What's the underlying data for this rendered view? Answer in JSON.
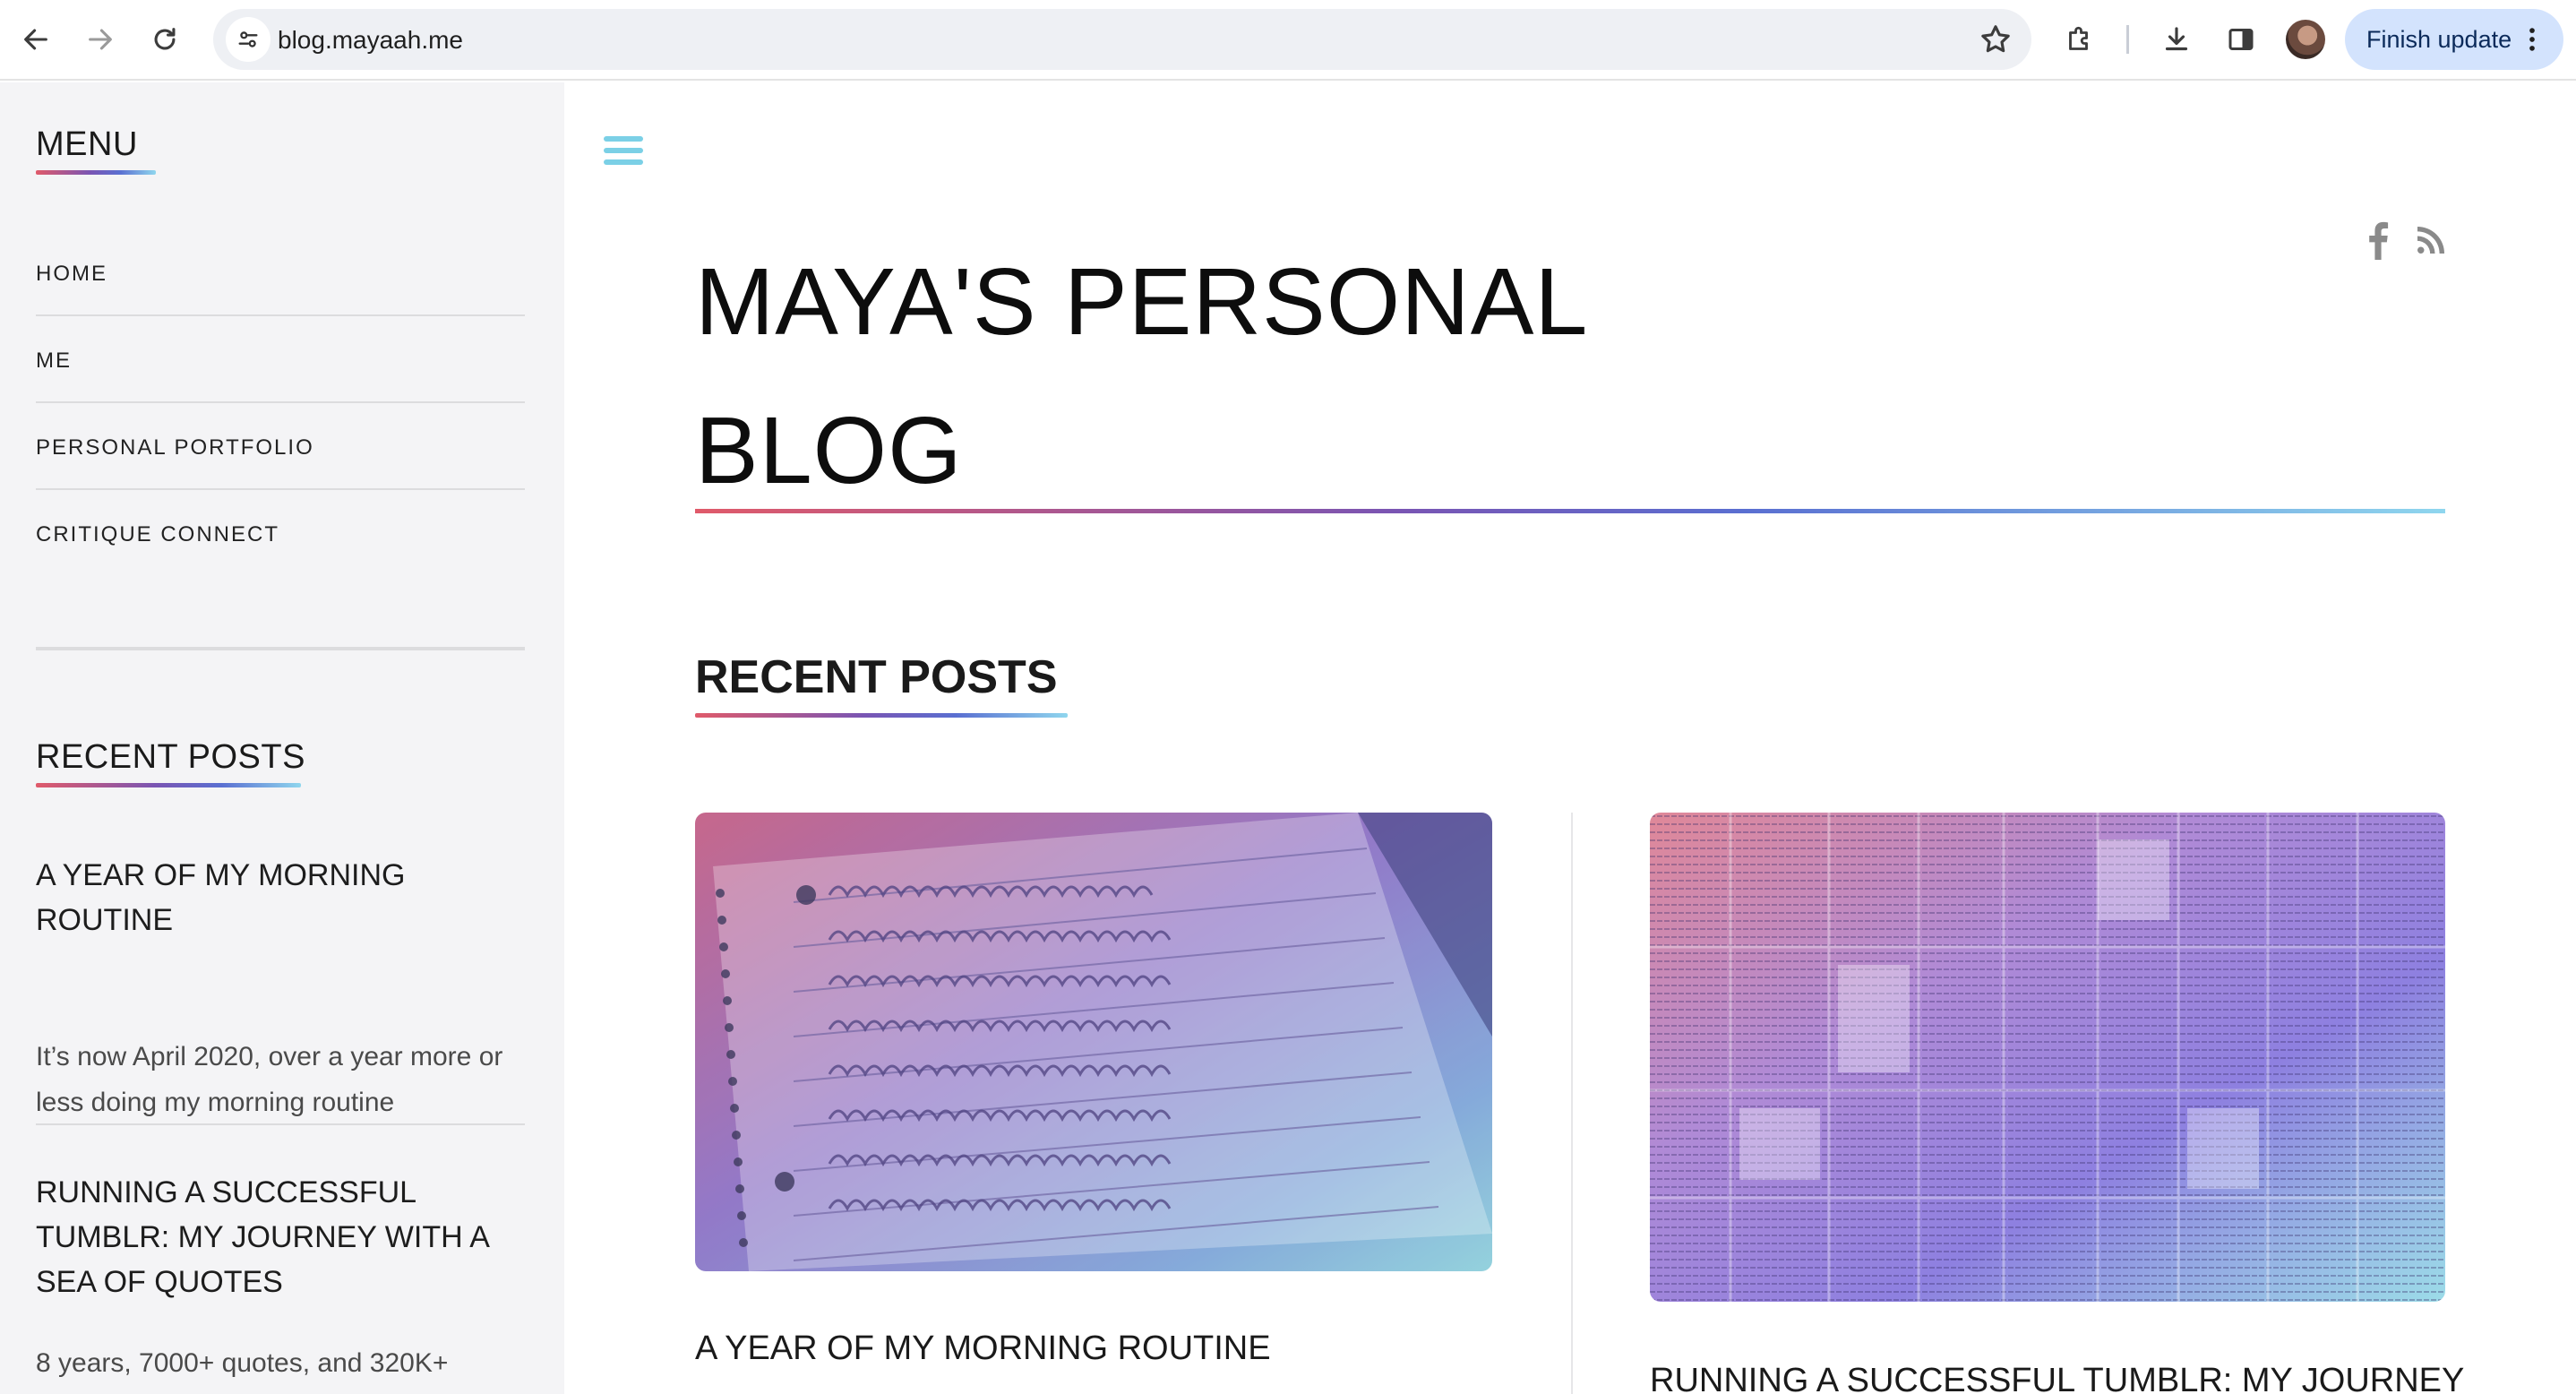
{
  "browser": {
    "url": "blog.mayaah.me",
    "finish_update_label": "Finish update"
  },
  "sidebar": {
    "menu_title": "MENU",
    "menu_items": [
      {
        "label": "HOME"
      },
      {
        "label": "ME"
      },
      {
        "label": "PERSONAL PORTFOLIO"
      },
      {
        "label": "CRITIQUE CONNECT"
      }
    ],
    "recent_title": "RECENT POSTS",
    "recent_posts": [
      {
        "title": "A YEAR OF MY MORNING ROUTINE",
        "excerpt": "It’s now April 2020, over a year more or less doing my morning routine"
      },
      {
        "title": "RUNNING A SUCCESSFUL TUMBLR: MY JOURNEY WITH A SEA OF QUOTES",
        "excerpt": "8 years, 7000+ quotes, and 320K+"
      }
    ]
  },
  "main": {
    "site_title": "MAYA'S PERSONAL BLOG",
    "recent_heading": "RECENT POSTS",
    "posts": [
      {
        "title": "A YEAR OF MY MORNING ROUTINE",
        "image": "handwritten-devanagari-notebook-photo"
      },
      {
        "title": "RUNNING A SUCCESSFUL TUMBLR: MY JOURNEY",
        "image": "collage-of-quote-screenshots"
      }
    ],
    "social_icons": [
      "facebook-icon",
      "rss-icon"
    ]
  },
  "colors": {
    "accent_gradient": [
      "#e05a6a",
      "#7a55b3",
      "#5a6fd1",
      "#8fd6ee"
    ],
    "hamburger": "#7bd0e6",
    "update_button_bg": "#d3e3fd"
  }
}
